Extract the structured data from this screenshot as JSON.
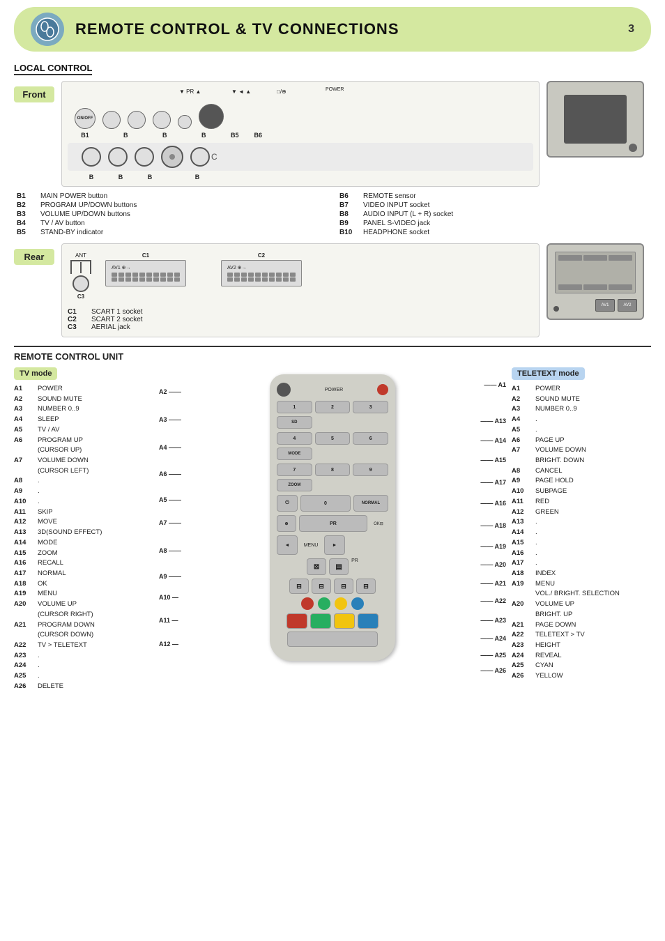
{
  "header": {
    "title": "REMOTE CONTROL & TV CONNECTIONS",
    "page_number": "3"
  },
  "local_control": {
    "title": "LOCAL CONTROL",
    "front_label": "Front",
    "rear_label": "Rear",
    "front_buttons": [
      {
        "id": "B1",
        "label": "B1",
        "desc": "MAIN POWER button",
        "text": "ON/OFF"
      },
      {
        "id": "B2",
        "label": "B2",
        "desc": "PROGRAM UP/DOWN buttons"
      },
      {
        "id": "B3",
        "label": "B3",
        "desc": "VOLUME UP/DOWN buttons"
      },
      {
        "id": "B4",
        "label": "B4",
        "desc": "TV / AV button"
      },
      {
        "id": "B5",
        "label": "B5",
        "desc": "STAND-BY indicator"
      },
      {
        "id": "B6",
        "label": "B6",
        "desc": "REMOTE sensor"
      },
      {
        "id": "B7",
        "label": "B7",
        "desc": "VIDEO INPUT socket"
      },
      {
        "id": "B8",
        "label": "B8",
        "desc": "AUDIO INPUT (L + R) socket"
      },
      {
        "id": "B9",
        "label": "B9",
        "desc": "PANEL S-VIDEO jack"
      },
      {
        "id": "B10",
        "label": "B10",
        "desc": "HEADPHONE socket"
      }
    ],
    "rear_connections": [
      {
        "id": "C1",
        "label": "C1",
        "desc": "SCART 1 socket"
      },
      {
        "id": "C2",
        "label": "C2",
        "desc": "SCART 2 socket"
      },
      {
        "id": "C3",
        "label": "C3",
        "desc": "AERIAL jack"
      }
    ]
  },
  "remote_control": {
    "title": "REMOTE CONTROL UNIT",
    "tv_mode_label": "TV mode",
    "teletext_mode_label": "TELETEXT mode",
    "tv_items": [
      {
        "key": "A1",
        "val": "POWER"
      },
      {
        "key": "A2",
        "val": "SOUND MUTE"
      },
      {
        "key": "A3",
        "val": "NUMBER 0..9"
      },
      {
        "key": "A4",
        "val": "SLEEP"
      },
      {
        "key": "A5",
        "val": "TV / AV"
      },
      {
        "key": "A6",
        "val": "PROGRAM UP (CURSOR UP)"
      },
      {
        "key": "A7",
        "val": "VOLUME DOWN (CURSOR LEFT)"
      },
      {
        "key": "A8",
        "val": "."
      },
      {
        "key": "A9",
        "val": "."
      },
      {
        "key": "A10",
        "val": "."
      },
      {
        "key": "A11",
        "val": "SKIP"
      },
      {
        "key": "A12",
        "val": "MOVE"
      },
      {
        "key": "A13",
        "val": "3D(SOUND EFFECT)"
      },
      {
        "key": "A14",
        "val": "MODE"
      },
      {
        "key": "A15",
        "val": "ZOOM"
      },
      {
        "key": "A16",
        "val": "RECALL"
      },
      {
        "key": "A17",
        "val": "NORMAL"
      },
      {
        "key": "A18",
        "val": "OK"
      },
      {
        "key": "A19",
        "val": "MENU"
      },
      {
        "key": "A20",
        "val": "VOLUME UP (CURSOR RIGHT)"
      },
      {
        "key": "A21",
        "val": "PROGRAM DOWN (CURSOR DOWN)"
      },
      {
        "key": "A22",
        "val": "TV > TELETEXT"
      },
      {
        "key": "A23",
        "val": "."
      },
      {
        "key": "A24",
        "val": "."
      },
      {
        "key": "A25",
        "val": "."
      },
      {
        "key": "A26",
        "val": "DELETE"
      }
    ],
    "teletext_items": [
      {
        "key": "A1",
        "val": "POWER"
      },
      {
        "key": "A2",
        "val": "SOUND MUTE"
      },
      {
        "key": "A3",
        "val": "NUMBER 0..9"
      },
      {
        "key": "A4",
        "val": "."
      },
      {
        "key": "A5",
        "val": "."
      },
      {
        "key": "A6",
        "val": "PAGE UP"
      },
      {
        "key": "A7",
        "val": "VOLUME DOWN BRIGHT. DOWN"
      },
      {
        "key": "A8",
        "val": "CANCEL"
      },
      {
        "key": "A9",
        "val": "PAGE HOLD"
      },
      {
        "key": "A10",
        "val": "SUBPAGE"
      },
      {
        "key": "A11",
        "val": "RED"
      },
      {
        "key": "A12",
        "val": "GREEN"
      },
      {
        "key": "A13",
        "val": "."
      },
      {
        "key": "A14",
        "val": "."
      },
      {
        "key": "A15",
        "val": "."
      },
      {
        "key": "A16",
        "val": "."
      },
      {
        "key": "A17",
        "val": "."
      },
      {
        "key": "A18",
        "val": "INDEX"
      },
      {
        "key": "A19",
        "val": "MENU"
      },
      {
        "key": "A20",
        "val": "VOLUME UP BRIGHT. UP"
      },
      {
        "key": "A21",
        "val": "PAGE DOWN"
      },
      {
        "key": "A22",
        "val": "TELETEXT > TV"
      },
      {
        "key": "A23",
        "val": "HEIGHT"
      },
      {
        "key": "A24",
        "val": "REVEAL"
      },
      {
        "key": "A25",
        "val": "CYAN"
      },
      {
        "key": "A26",
        "val": "YELLOW"
      }
    ]
  }
}
